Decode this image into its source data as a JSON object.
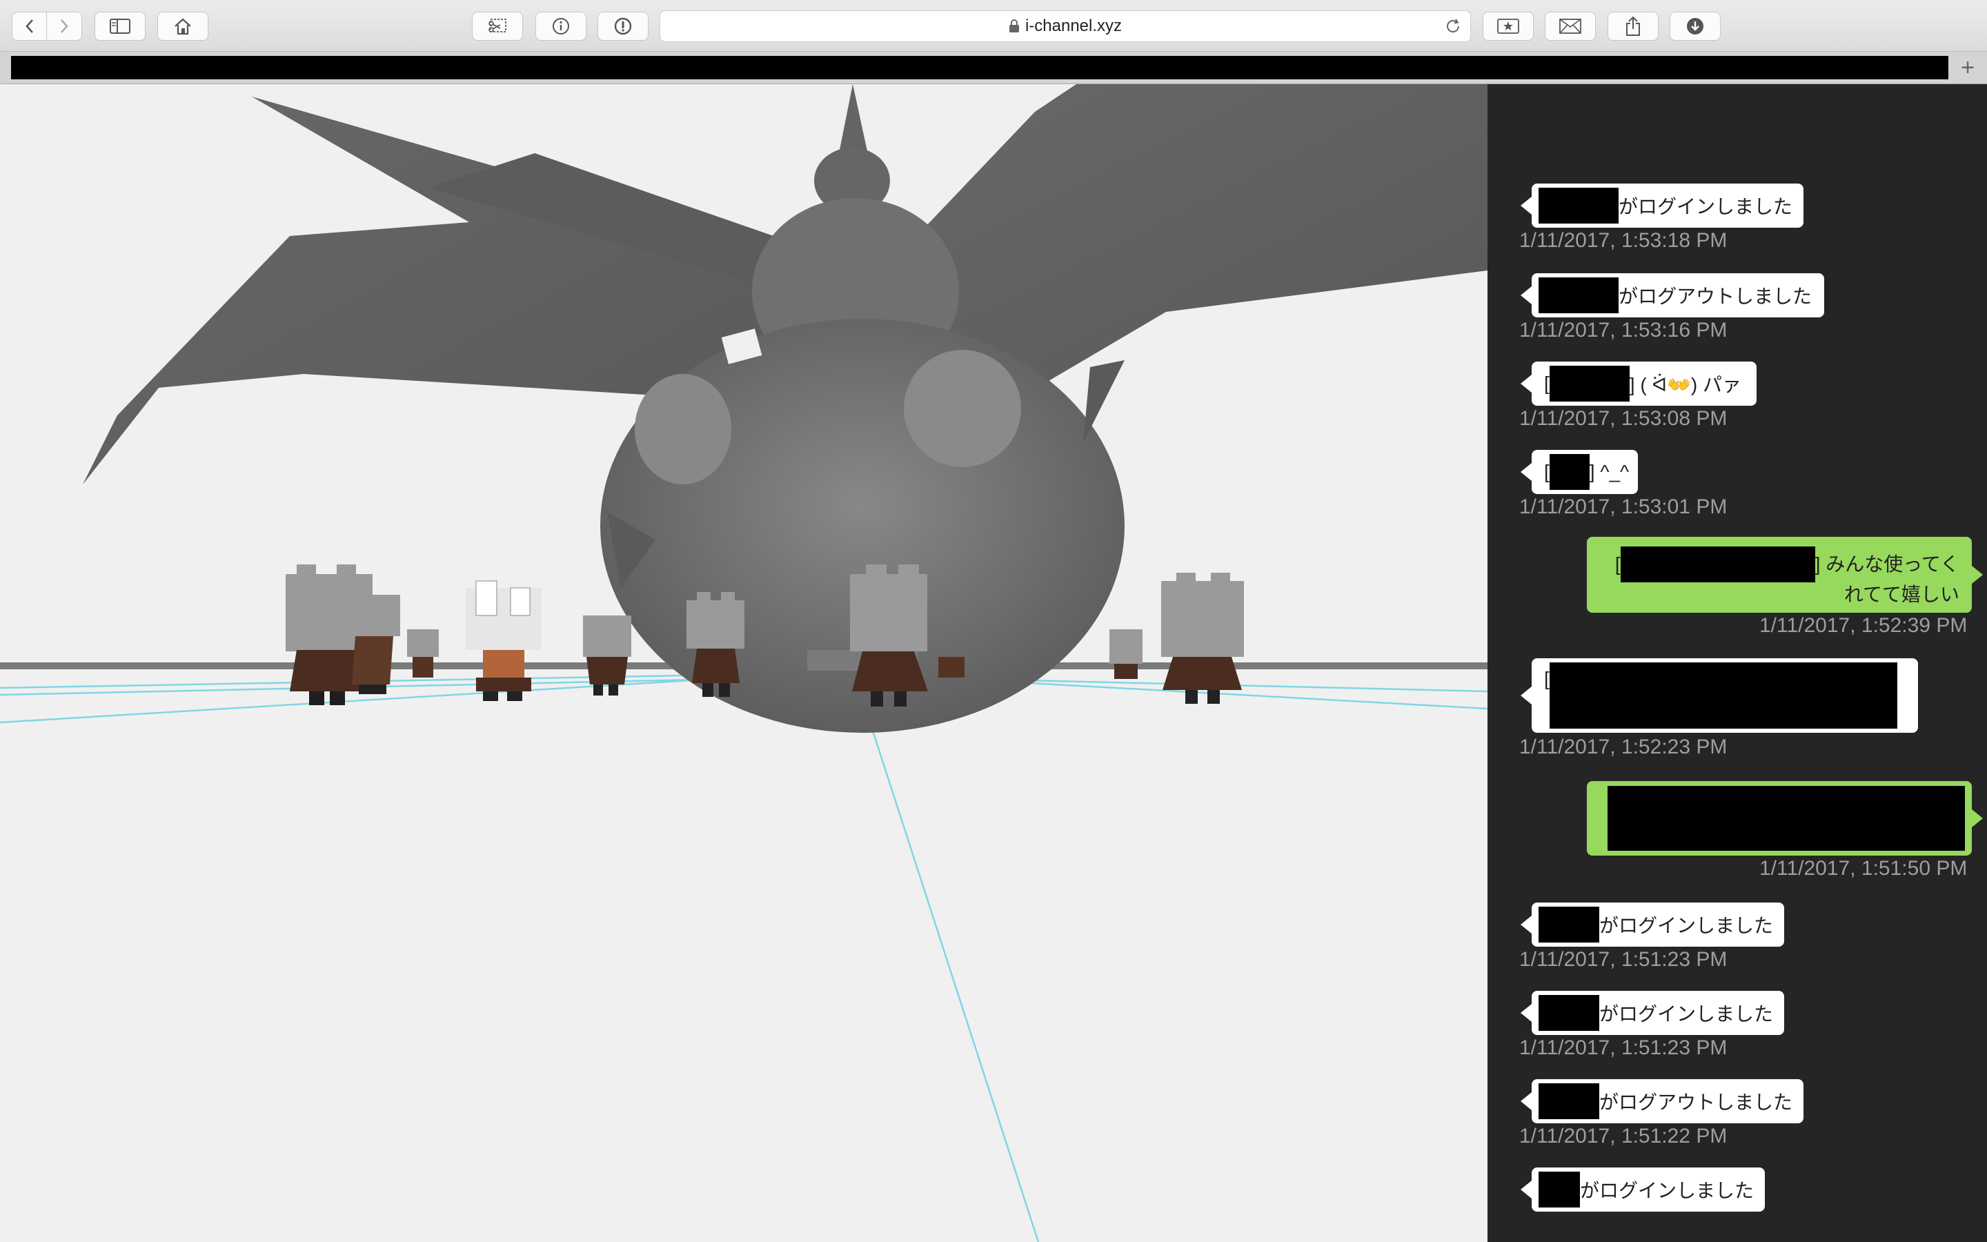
{
  "browser": {
    "url": "i-channel.xyz",
    "new_tab": "+"
  },
  "chat": {
    "messages": [
      {
        "suffix": "がログインしました",
        "time": "1/11/2017, 1:53:18 PM"
      },
      {
        "suffix": "がログアウトしました",
        "time": "1/11/2017, 1:53:16 PM"
      },
      {
        "prefix": "[",
        "suffix": "] ( ᐛ👐) パァ",
        "time": "1/11/2017, 1:53:08 PM"
      },
      {
        "prefix": "[",
        "suffix": "] ^_^",
        "time": "1/11/2017, 1:53:01 PM"
      },
      {
        "prefix": "[",
        "line1_suffix": "] みんな使ってく",
        "line2": "れてて嬉しい",
        "time": "1/11/2017, 1:52:39 PM"
      },
      {
        "prefix": "[",
        "time": "1/11/2017, 1:52:23 PM"
      },
      {
        "time": "1/11/2017, 1:51:50 PM"
      },
      {
        "suffix": "がログインしました",
        "time": "1/11/2017, 1:51:23 PM"
      },
      {
        "suffix": "がログインしました",
        "time": "1/11/2017, 1:51:23 PM"
      },
      {
        "suffix": "がログアウトしました",
        "time": "1/11/2017, 1:51:22 PM"
      },
      {
        "suffix": "がログインしました"
      }
    ]
  },
  "colors": {
    "chat_background": "#252525",
    "incoming_bubble": "#ffffff",
    "outgoing_bubble": "#97d95c",
    "timestamp": "#9e9e9e",
    "scene_background": "#f0f0f0",
    "grid_line": "#7fd6e6"
  },
  "icons": [
    "chevron-left-icon",
    "chevron-right-icon",
    "sidebar-icon",
    "home-icon",
    "screenshot-icon",
    "info-icon",
    "password-icon",
    "lock-icon",
    "reload-icon",
    "bookmark-icon",
    "mail-icon",
    "share-icon",
    "download-icon",
    "plus-icon"
  ]
}
